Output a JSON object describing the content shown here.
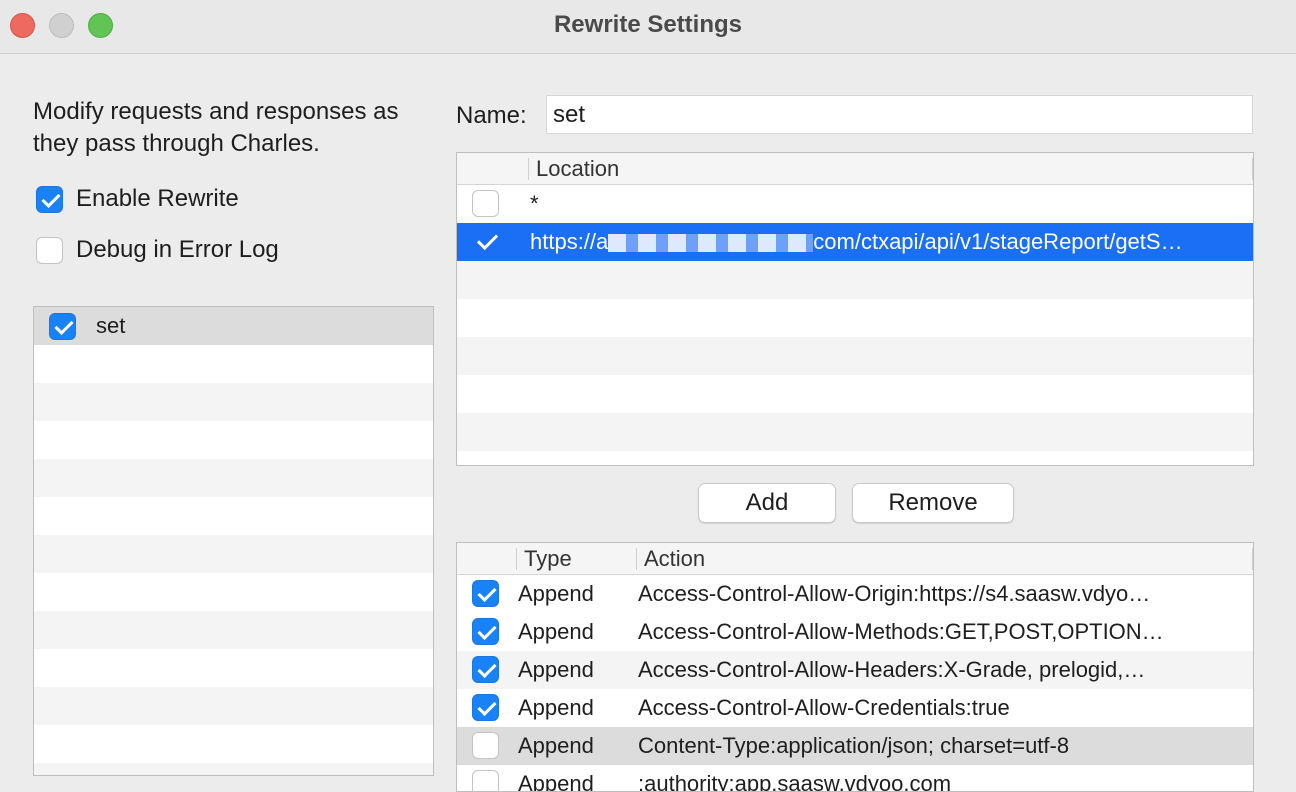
{
  "window": {
    "title": "Rewrite Settings"
  },
  "left": {
    "description": "Modify requests and responses as they pass through Charles.",
    "enable_rewrite": {
      "label": "Enable Rewrite",
      "checked": true
    },
    "debug_error_log": {
      "label": "Debug in Error Log",
      "checked": false
    },
    "sets": [
      {
        "label": "set",
        "checked": true
      }
    ]
  },
  "name": {
    "label": "Name:",
    "value": "set"
  },
  "locations": {
    "header": "Location",
    "rows": [
      {
        "checked": false,
        "text": "*"
      },
      {
        "checked": true,
        "text_prefix": "https://a",
        "text_suffix": "com/ctxapi/api/v1/stageReport/getS…",
        "selected": true
      }
    ]
  },
  "buttons": {
    "add": "Add",
    "remove": "Remove"
  },
  "actions": {
    "headers": {
      "type": "Type",
      "action": "Action"
    },
    "rows": [
      {
        "checked": true,
        "type": "Append",
        "action": "Access-Control-Allow-Origin:https://s4.saasw.vdyo…"
      },
      {
        "checked": true,
        "type": "Append",
        "action": "Access-Control-Allow-Methods:GET,POST,OPTION…"
      },
      {
        "checked": true,
        "type": "Append",
        "action": "Access-Control-Allow-Headers:X-Grade, prelogid,…"
      },
      {
        "checked": true,
        "type": "Append",
        "action": "Access-Control-Allow-Credentials:true"
      },
      {
        "checked": false,
        "type": "Append",
        "action": "Content-Type:application/json; charset=utf-8"
      },
      {
        "checked": false,
        "type": "Append",
        "action": ":authority:app.saasw.vdyoo.com"
      }
    ]
  }
}
